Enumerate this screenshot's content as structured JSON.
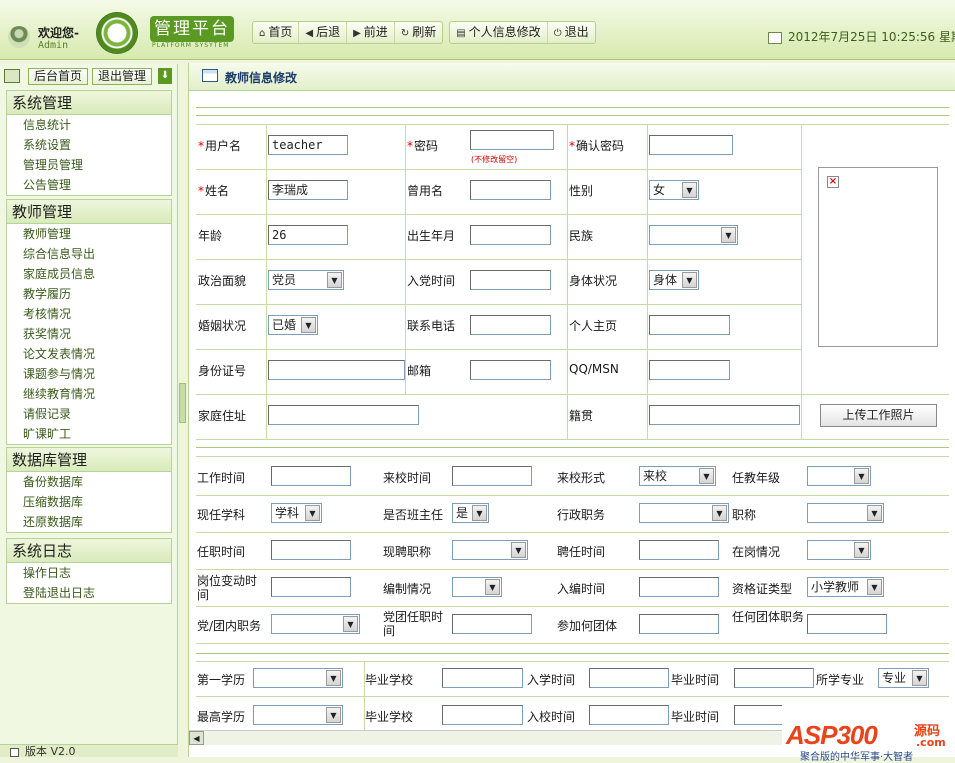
{
  "header": {
    "welcome": "欢迎您-",
    "username": "Admin",
    "brand": "管理平台",
    "brand_sub": "PLATFORM SYSYTEM",
    "nav": [
      "首页",
      "后退",
      "前进",
      "刷新"
    ],
    "nav2": [
      "个人信息修改",
      "退出"
    ],
    "datetime": "2012年7月25日 10:25:56 星期三"
  },
  "sidebar": {
    "top_buttons": [
      "后台首页",
      "退出管理"
    ],
    "sections": [
      {
        "title": "系统管理",
        "items": [
          "信息统计",
          "系统设置",
          "管理员管理",
          "公告管理"
        ]
      },
      {
        "title": "教师管理",
        "items": [
          "教师管理",
          "综合信息导出",
          "家庭成员信息",
          "教学履历",
          "考核情况",
          "获奖情况",
          "论文发表情况",
          "课题参与情况",
          "继续教育情况",
          "请假记录",
          "旷课旷工"
        ]
      },
      {
        "title": "数据库管理",
        "items": [
          "备份数据库",
          "压缩数据库",
          "还原数据库"
        ]
      },
      {
        "title": "系统日志",
        "items": [
          "操作日志",
          "登陆退出日志"
        ]
      }
    ],
    "version": "版本 V2.0"
  },
  "panel": {
    "title": "教师信息修改"
  },
  "form1": {
    "username_label": "用户名",
    "username_value": "teacher",
    "password_label": "密码",
    "password_hint": "(不修改留空)",
    "confirm_label": "确认密码",
    "name_label": "姓名",
    "name_value": "李瑞成",
    "former_name_label": "曾用名",
    "gender_label": "性别",
    "gender_value": "女",
    "age_label": "年龄",
    "age_value": "26",
    "birth_label": "出生年月",
    "ethnic_label": "民族",
    "political_label": "政治面貌",
    "political_value": "党员",
    "party_date_label": "入党时间",
    "health_label": "身体状况",
    "health_value": "身体",
    "marital_label": "婚姻状况",
    "marital_value": "已婚",
    "phone_label": "联系电话",
    "homepage_label": "个人主页",
    "idcard_label": "身份证号",
    "email_label": "邮箱",
    "qq_label": "QQ/MSN",
    "address_label": "家庭住址",
    "native_label": "籍贯",
    "upload_button": "上传工作照片"
  },
  "form2": {
    "work_time_label": "工作时间",
    "arrive_time_label": "来校时间",
    "arrive_form_label": "来校形式",
    "arrive_form_value": "来校",
    "grade_label": "任教年级",
    "subject_label": "现任学科",
    "subject_value": "学科",
    "head_teacher_label": "是否班主任",
    "head_teacher_value": "是",
    "admin_post_label": "行政职务",
    "title_label": "职称",
    "appoint_time_label": "任职时间",
    "current_title_label": "现聘职称",
    "hire_time_label": "聘任时间",
    "on_post_label": "在岗情况",
    "post_change_label": "岗位变动时间",
    "staffing_label": "编制情况",
    "enroll_time_label": "入编时间",
    "cert_type_label": "资格证类型",
    "cert_type_value": "小学教师",
    "party_post_label": "党/团内职务",
    "party_post_time_label": "党团任职时间",
    "group_label": "参加何团体",
    "group_post_label": "任何团体职务"
  },
  "form3": {
    "first_edu_label": "第一学历",
    "grad_school_label": "毕业学校",
    "enter_time_label": "入学时间",
    "grad_time_label": "毕业时间",
    "major_label": "所学专业",
    "major_value": "专业",
    "top_edu_label": "最高学历",
    "grad_school2_label": "毕业学校",
    "enter_school_label": "入校时间",
    "grad_time2_label": "毕业时间"
  },
  "watermark": {
    "text": "ASP300",
    "cn": "源码",
    "domain": ".com",
    "sub": "聚合版的中华军事·大智者"
  }
}
